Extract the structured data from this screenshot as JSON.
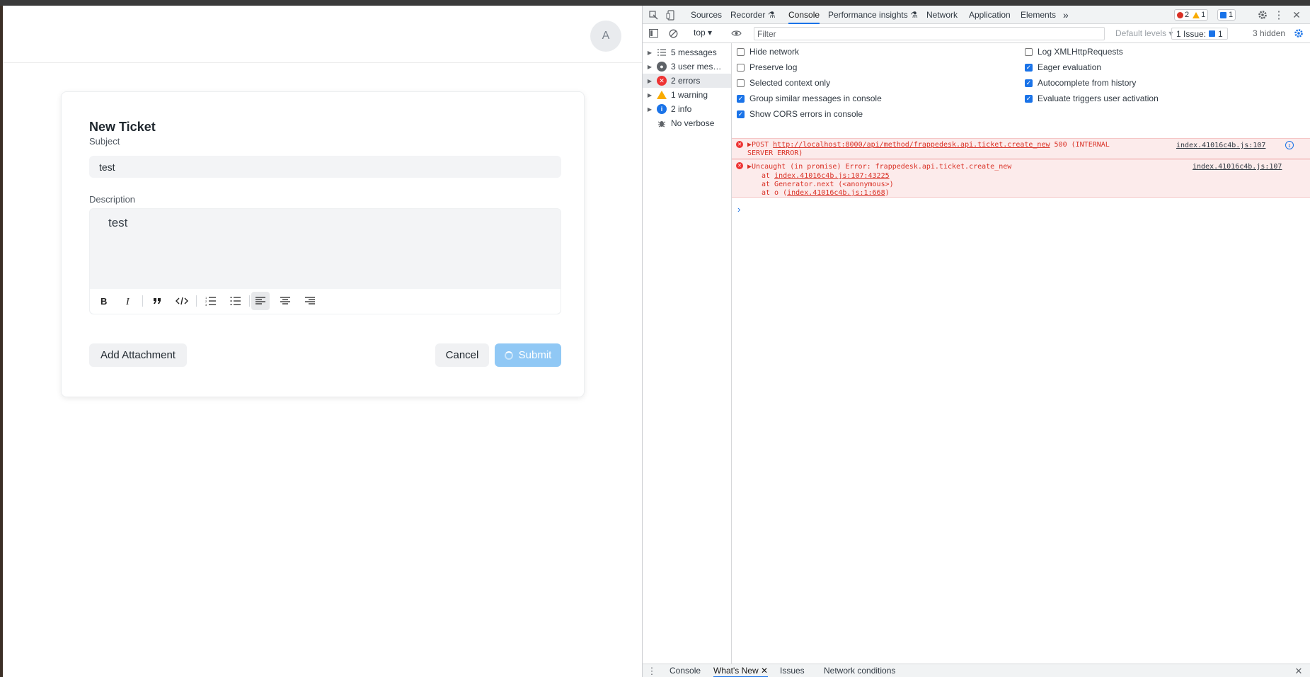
{
  "app": {
    "avatar_letter": "A",
    "form_title": "New Ticket",
    "subject_label": "Subject",
    "subject_value": "test",
    "description_label": "Description",
    "description_value": "test",
    "attach_label": "Add Attachment",
    "cancel_label": "Cancel",
    "submit_label": "Submit",
    "submit_color": "#90c8f5"
  },
  "devtools": {
    "tabs": [
      "Sources",
      "Recorder",
      "Console",
      "Performance insights",
      "Network",
      "Application",
      "Elements"
    ],
    "active_tab": "Console",
    "more_tabs_glyph": "»",
    "error_count": "2",
    "warning_count": "1",
    "message_count": "1",
    "context": "top",
    "filter_placeholder": "Filter",
    "levels_label": "Default levels",
    "issue_label": "1 Issue:",
    "issue_count": "1",
    "hidden_label": "3 hidden",
    "sidebar": [
      {
        "label": "5 messages",
        "icon": "list-icon"
      },
      {
        "label": "3 user mes…",
        "icon": "user-icon"
      },
      {
        "label": "2 errors",
        "icon": "error-icon"
      },
      {
        "label": "1 warning",
        "icon": "warning-icon"
      },
      {
        "label": "2 info",
        "icon": "info-icon"
      },
      {
        "label": "No verbose",
        "icon": "bug-icon"
      }
    ],
    "settings_left": [
      {
        "label": "Hide network",
        "checked": false
      },
      {
        "label": "Preserve log",
        "checked": false
      },
      {
        "label": "Selected context only",
        "checked": false
      },
      {
        "label": "Group similar messages in console",
        "checked": true
      },
      {
        "label": "Show CORS errors in console",
        "checked": true
      }
    ],
    "settings_right": [
      {
        "label": "Log XMLHttpRequests",
        "checked": false
      },
      {
        "label": "Eager evaluation",
        "checked": true
      },
      {
        "label": "Autocomplete from history",
        "checked": true
      },
      {
        "label": "Evaluate triggers user activation",
        "checked": true
      }
    ],
    "log1": {
      "method": "POST",
      "url": "http://localhost:8000/api/method/frappedesk.api.ticket.create_new",
      "status": "500 (INTERNAL",
      "status_cont": "SERVER ERROR)",
      "source": "index.41016c4b.js:107"
    },
    "log2": {
      "message": "Uncaught (in promise) Error: frappedesk.api.ticket.create_new",
      "stack1_prefix": "at ",
      "stack1_link": "index.41016c4b.js:107:43225",
      "stack2": "at Generator.next (<anonymous>)",
      "stack3_prefix": "at o (",
      "stack3_link": "index.41016c4b.js:1:668",
      "stack3_suffix": ")",
      "source": "index.41016c4b.js:107"
    },
    "prompt": "›",
    "drawer_tabs": [
      "Console",
      "What's New",
      "Issues",
      "Network conditions"
    ],
    "drawer_active": "What's New"
  }
}
